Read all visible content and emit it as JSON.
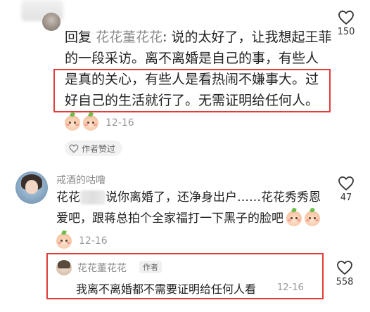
{
  "top_comment": {
    "reply_prefix": "回复",
    "reply_to": "花花董花花",
    "text_lines": [
      "说的太好了，让我想起王菲",
      "的一段采访。离不离婚是自己的事，有些人",
      "是真的关心，有些人是看热闹不嫌事大。过",
      "好自己的生活就行了。无需证明给任何人。"
    ],
    "date": "12-16",
    "likes": "150",
    "author_liked_label": "作者赞过"
  },
  "second_comment": {
    "username": "戒酒的咕噜",
    "text_line1_a": "花花",
    "text_line1_b": "说你离婚了，还净身出户……花花秀秀恩",
    "text_line2": "爱吧，跟蒋总拍个全家福打一下黑子的脸吧",
    "date": "12-16",
    "likes": "47"
  },
  "author_reply": {
    "username": "花花董花花",
    "tag": "作者",
    "text": "我离不离婚都不需要证明给任何人看",
    "date": "12-16",
    "likes": "558"
  },
  "colors": {
    "highlight_box": "#e23b3b",
    "secondary_text": "#8a8a8a",
    "time_text": "#999999"
  }
}
